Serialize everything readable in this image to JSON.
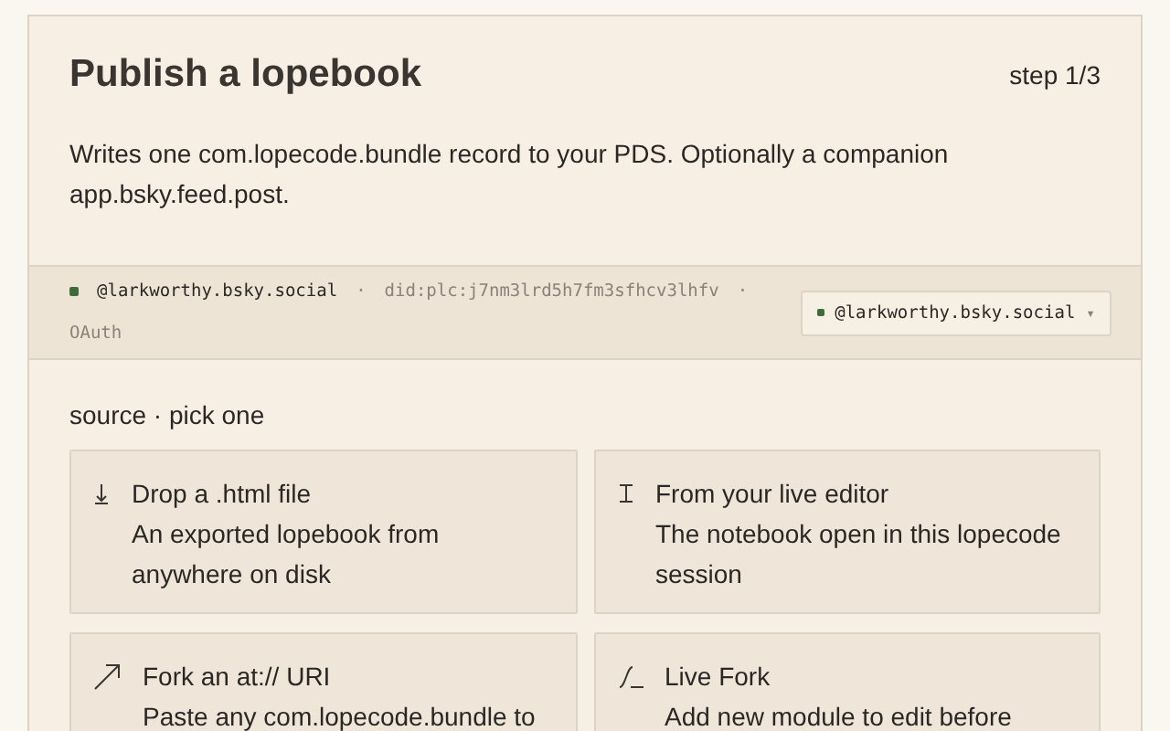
{
  "header": {
    "title": "Publish a lopebook",
    "step": "step 1/3",
    "description": "Writes one com.lopecode.bundle record to your PDS. Optionally a companion app.bsky.feed.post."
  },
  "account": {
    "signed_in": true,
    "handle": "@larkworthy.bsky.social",
    "separator": "·",
    "did": "did:plc:j7nm3lrd5h7fm3sfhcv3lhfv",
    "auth": "OAuth",
    "picker": {
      "signed_in": true,
      "handle": "@larkworthy.bsky.social",
      "caret": "▾"
    }
  },
  "source": {
    "label": "source · pick one",
    "options": [
      {
        "kind": "file",
        "title": "Drop a .html file",
        "description": "An exported lopebook from anywhere on disk"
      },
      {
        "kind": "editor",
        "title": "From your live editor",
        "description": "The notebook open in this lopecode session"
      },
      {
        "kind": "uri",
        "title": "Fork an at:// URI",
        "description": "Paste any com.lopecode.bundle to"
      },
      {
        "kind": "live",
        "title": "Live Fork",
        "description": "Add new module to edit before"
      }
    ]
  }
}
